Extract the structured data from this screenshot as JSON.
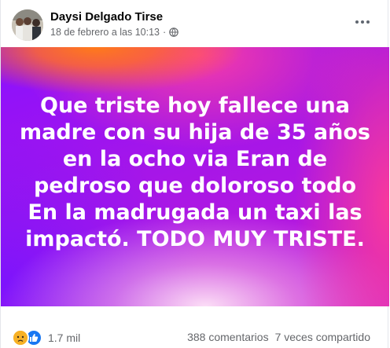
{
  "post": {
    "author": "Daysi Delgado Tirse",
    "date": "18 de febrero a las 10:13",
    "separator": "·",
    "privacy_icon": "globe-icon",
    "body": "Que triste hoy fallece una madre con su hija de 35 años en la ocho via Eran de pedroso que doloroso todo En la madrugada un taxi las impactó. TODO MUY TRISTE."
  },
  "footer": {
    "reactions": [
      "sad-icon",
      "like-icon"
    ],
    "reaction_count": "1.7 mil",
    "comments": "388 comentarios",
    "shares": "7 veces compartido"
  },
  "colors": {
    "background_purple": "#9a12f0",
    "background_orange": "#ff6a2b",
    "background_pink": "#ff3ea0",
    "like_blue": "#1877f2",
    "sad_yellow": "#f7b125"
  }
}
